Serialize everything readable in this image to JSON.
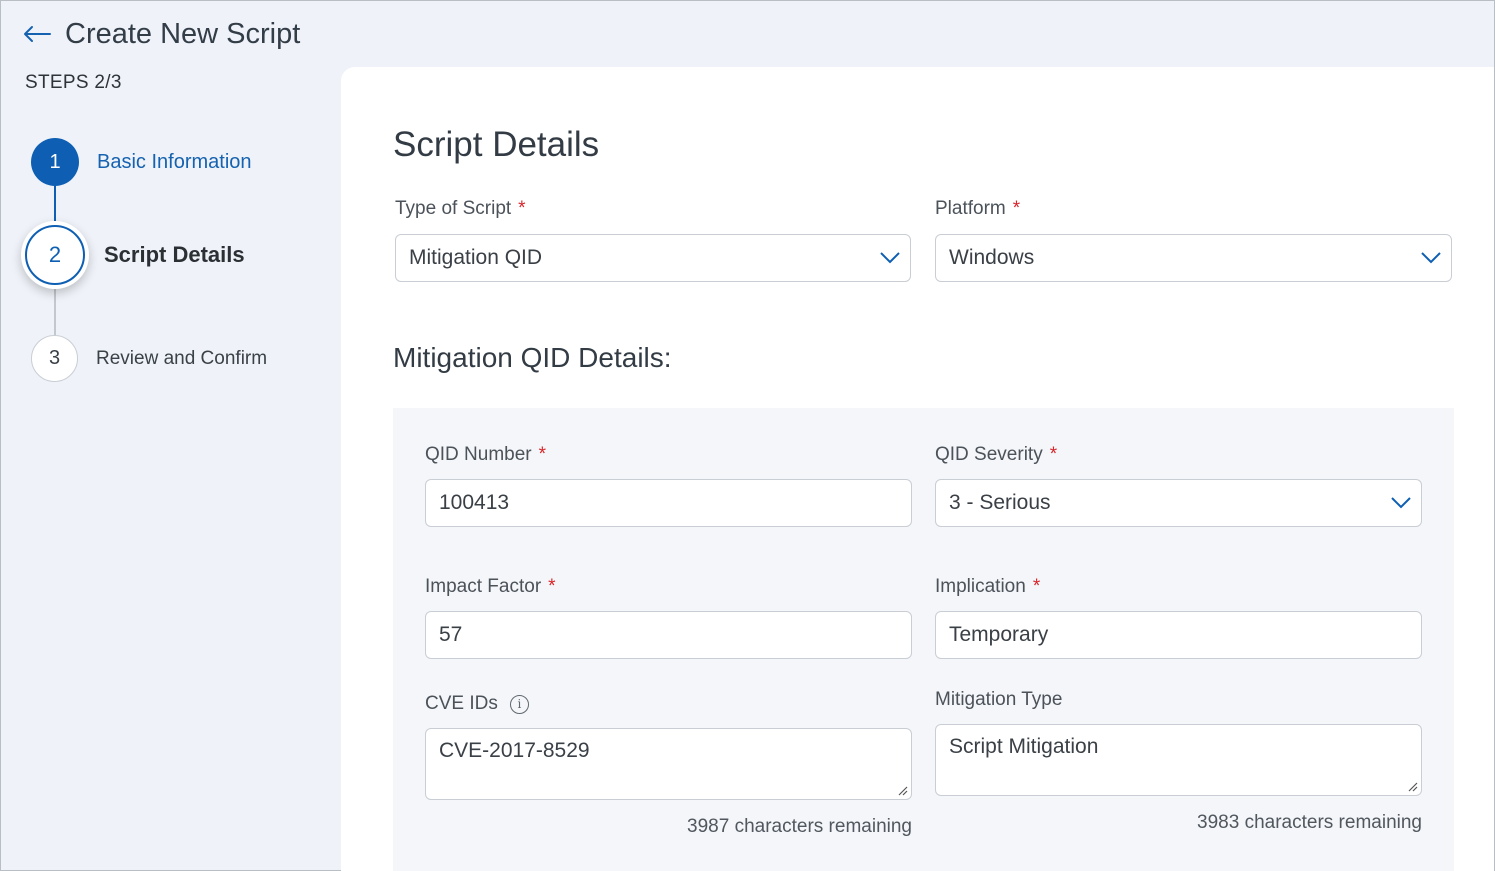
{
  "header": {
    "title": "Create New Script",
    "back_icon": "arrow-left-icon"
  },
  "sidebar": {
    "steps_label": "STEPS 2/3",
    "steps": [
      {
        "number": "1",
        "label": "Basic Information",
        "state": "completed"
      },
      {
        "number": "2",
        "label": "Script Details",
        "state": "active"
      },
      {
        "number": "3",
        "label": "Review and Confirm",
        "state": "pending"
      }
    ]
  },
  "main": {
    "title": "Script Details",
    "type_of_script": {
      "label": "Type of Script",
      "required_mark": "*",
      "value": "Mitigation QID"
    },
    "platform": {
      "label": "Platform",
      "required_mark": "*",
      "value": "Windows"
    },
    "subtitle": "Mitigation QID Details:",
    "qid_number": {
      "label": "QID Number",
      "required_mark": "*",
      "value": "100413"
    },
    "qid_severity": {
      "label": "QID Severity",
      "required_mark": "*",
      "value": "3 - Serious"
    },
    "impact_factor": {
      "label": "Impact Factor",
      "required_mark": "*",
      "value": "57"
    },
    "implication": {
      "label": "Implication",
      "required_mark": "*",
      "value": "Temporary"
    },
    "cve_ids": {
      "label": "CVE IDs",
      "info_glyph": "i",
      "value": "CVE-2017-8529",
      "remaining": "3987 characters remaining"
    },
    "mitigation_type": {
      "label": "Mitigation Type",
      "value": "Script Mitigation",
      "remaining": "3983 characters remaining"
    }
  },
  "colors": {
    "accent": "#0e5fb3",
    "required": "#d8262b",
    "background": "#eff3f9",
    "panel": "#f4f6f9"
  }
}
